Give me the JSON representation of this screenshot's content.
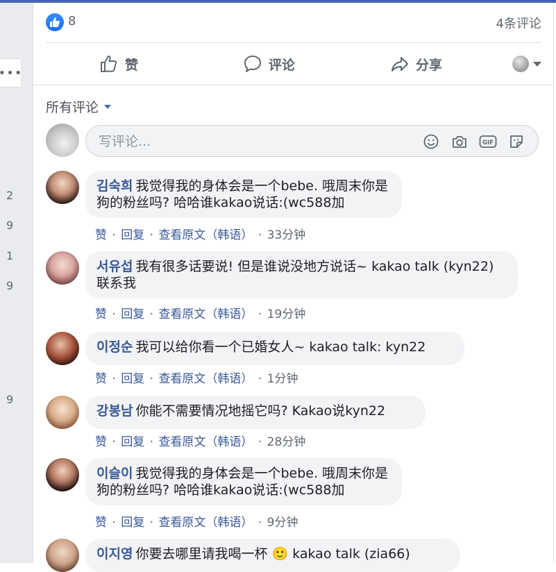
{
  "counts": {
    "likes": "8",
    "comments_label": "4条评论"
  },
  "actions": {
    "like": "赞",
    "comment": "评论",
    "share": "分享"
  },
  "filter": {
    "label": "所有评论"
  },
  "composer": {
    "placeholder": "写评论..."
  },
  "side_numbers": [
    "2",
    "9",
    "1",
    "9",
    "9"
  ],
  "comments": [
    {
      "author": "김숙희",
      "text": "我觉得我的身体会是一个bebe. 哦周末你是狗的粉丝吗? 哈哈谁kakao说话:(wc588加",
      "like": "赞",
      "reply": "回复",
      "see_original": "查看原文（韩语）",
      "time": "33分钟"
    },
    {
      "author": "서유섭",
      "text": "我有很多话要说! 但是谁说没地方说话~ kakao talk (kyn22)联系我",
      "like": "赞",
      "reply": "回复",
      "see_original": "查看原文（韩语）",
      "time": "19分钟"
    },
    {
      "author": "이정순",
      "text": "我可以给你看一个已婚女人~ kakao talk: kyn22",
      "like": "赞",
      "reply": "回复",
      "see_original": "查看原文（韩语）",
      "time": "1分钟"
    },
    {
      "author": "강봉남",
      "text": "你能不需要情况地摇它吗? Kakao说kyn22",
      "like": "赞",
      "reply": "回复",
      "see_original": "查看原文（韩语）",
      "time": "28分钟"
    },
    {
      "author": "이슬이",
      "text": "我觉得我的身体会是一个bebe. 哦周末你是狗的粉丝吗? 哈哈谁kakao说话:(wc588加",
      "like": "赞",
      "reply": "回复",
      "see_original": "查看原文（韩语）",
      "time": "9分钟"
    },
    {
      "author": "이지영",
      "text": "你要去哪里请我喝一杯 🙂 kakao talk (zia66)"
    }
  ]
}
